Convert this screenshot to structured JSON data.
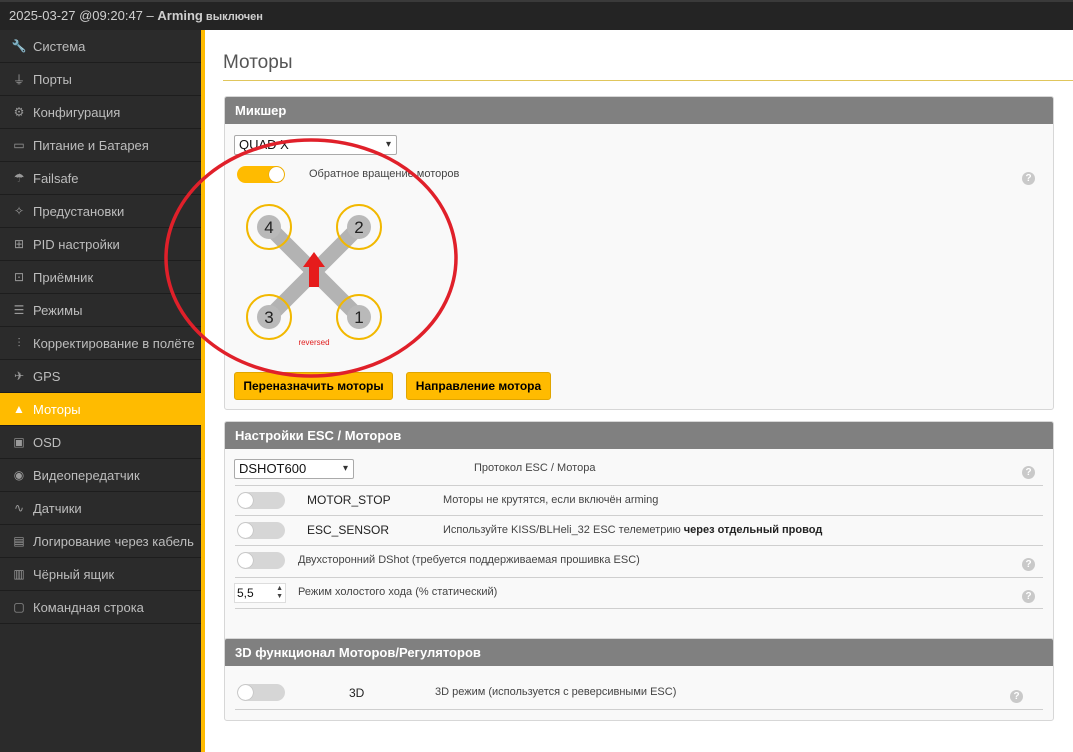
{
  "topbar": {
    "timestamp": "2025-03-27 @09:20:47 – ",
    "arming": "Arming",
    "arming_state": " выключен"
  },
  "sidebar": {
    "items": [
      {
        "label": "Система",
        "icon": "wrench-icon"
      },
      {
        "label": "Порты",
        "icon": "plug-icon"
      },
      {
        "label": "Конфигурация",
        "icon": "gear-icon"
      },
      {
        "label": "Питание и Батарея",
        "icon": "battery-icon"
      },
      {
        "label": "Failsafe",
        "icon": "parachute-icon"
      },
      {
        "label": "Предустановки",
        "icon": "magic-wand-icon"
      },
      {
        "label": "PID настройки",
        "icon": "pid-tree-icon"
      },
      {
        "label": "Приёмник",
        "icon": "remote-control-icon"
      },
      {
        "label": "Режимы",
        "icon": "modes-icon"
      },
      {
        "label": "Корректирование в полёте",
        "icon": "sliders-icon"
      },
      {
        "label": "GPS",
        "icon": "satellite-icon"
      },
      {
        "label": "Моторы",
        "icon": "motor-icon"
      },
      {
        "label": "OSD",
        "icon": "osd-icon"
      },
      {
        "label": "Видеопередатчик",
        "icon": "broadcast-icon"
      },
      {
        "label": "Датчики",
        "icon": "pulse-icon"
      },
      {
        "label": "Логирование через кабель",
        "icon": "cable-log-icon"
      },
      {
        "label": "Чёрный ящик",
        "icon": "blackbox-icon"
      },
      {
        "label": "Командная строка",
        "icon": "terminal-icon"
      }
    ],
    "active_index": 11
  },
  "main": {
    "title": "Моторы",
    "mixer": {
      "header": "Микшер",
      "mixer_value": "QUAD X",
      "reverse_label": "Обратное вращение моторов",
      "reverse_on": true,
      "motor_numbers": [
        "4",
        "2",
        "3",
        "1"
      ],
      "reversed_text": "reversed",
      "btn_reassign": "Переназначить моторы",
      "btn_direction": "Направление мотора",
      "help": "?"
    },
    "esc": {
      "header": "Настройки ESC / Моторов",
      "protocol_value": "DSHOT600",
      "protocol_label": "Протокол ESC / Мотора",
      "motor_stop_name": "MOTOR_STOP",
      "motor_stop_desc": "Моторы не крутятся, если включён arming",
      "esc_sensor_name": "ESC_SENSOR",
      "esc_sensor_desc": "Используйте KISS/BLHeli_32 ESC телеметрию ",
      "esc_sensor_desc_bold": "через отдельный провод",
      "bidir_label": "Двухсторонний DShot (требуется поддерживаемая прошивка ESC)",
      "idle_value": "5,5",
      "idle_label": "Режим холостого хода (% статический)",
      "help": "?"
    },
    "three_d": {
      "header": "3D функционал Моторов/Регуляторов",
      "name": "3D",
      "desc": "3D режим (используется с реверсивными ESC)",
      "help": "?"
    }
  },
  "colors": {
    "accent": "#ffbb00",
    "annotation_circle": "#e0202a",
    "reversed_text": "#e02020"
  }
}
